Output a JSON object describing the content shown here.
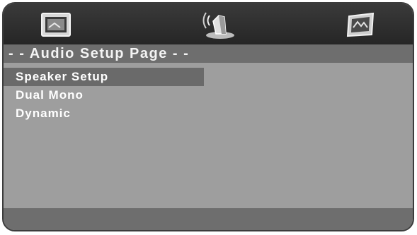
{
  "tabs": [
    {
      "icon": "tv-screen-icon",
      "selected": false
    },
    {
      "icon": "speaker-icon",
      "selected": true
    },
    {
      "icon": "preferences-icon",
      "selected": false
    }
  ],
  "header": {
    "title": "- - Audio Setup Page - -"
  },
  "menu": {
    "items": [
      {
        "label": "Speaker Setup",
        "selected": true
      },
      {
        "label": "Dual Mono",
        "selected": false
      },
      {
        "label": "Dynamic",
        "selected": false
      }
    ]
  },
  "colors": {
    "panel": "#9e9e9e",
    "iconbar": "#2f2f2f",
    "header": "#6e6e6e",
    "selected_row": "#6a6a6a",
    "text": "#ffffff"
  }
}
